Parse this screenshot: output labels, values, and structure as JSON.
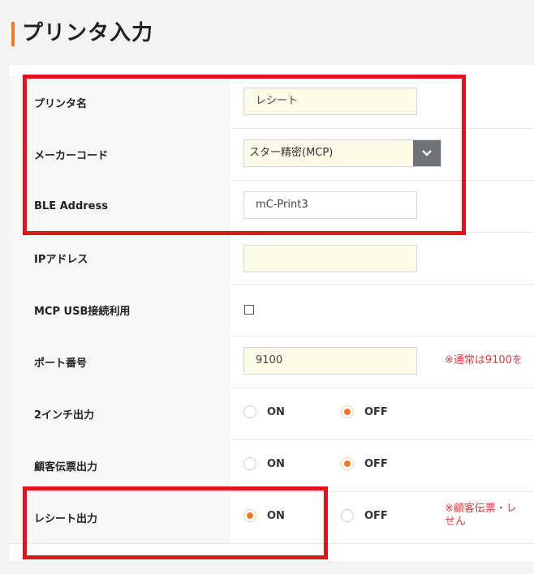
{
  "page": {
    "title": "プリンタ入力"
  },
  "form": {
    "printer_name": {
      "label": "プリンタ名",
      "value": "レシート"
    },
    "maker_code": {
      "label": "メーカーコード",
      "value": "スター精密(MCP)"
    },
    "ble_address": {
      "label": "BLE Address",
      "value": "mC-Print3"
    },
    "ip_address": {
      "label": "IPアドレス",
      "value": ""
    },
    "mcp_usb": {
      "label": "MCP USB接続利用",
      "checked": false
    },
    "port": {
      "label": "ポート番号",
      "value": "9100",
      "note": "※通常は9100を"
    },
    "two_inch": {
      "label": "2インチ出力",
      "on": "ON",
      "off": "OFF",
      "selected": "OFF"
    },
    "customer_slip": {
      "label": "顧客伝票出力",
      "on": "ON",
      "off": "OFF",
      "selected": "OFF"
    },
    "receipt_output": {
      "label": "レシート出力",
      "on": "ON",
      "off": "OFF",
      "selected": "ON",
      "note_line1": "※顧客伝票・レ",
      "note_line2": "せん"
    }
  },
  "colors": {
    "accent": "#f07a2a",
    "highlight": "#e3131b",
    "note": "#e8393d"
  }
}
